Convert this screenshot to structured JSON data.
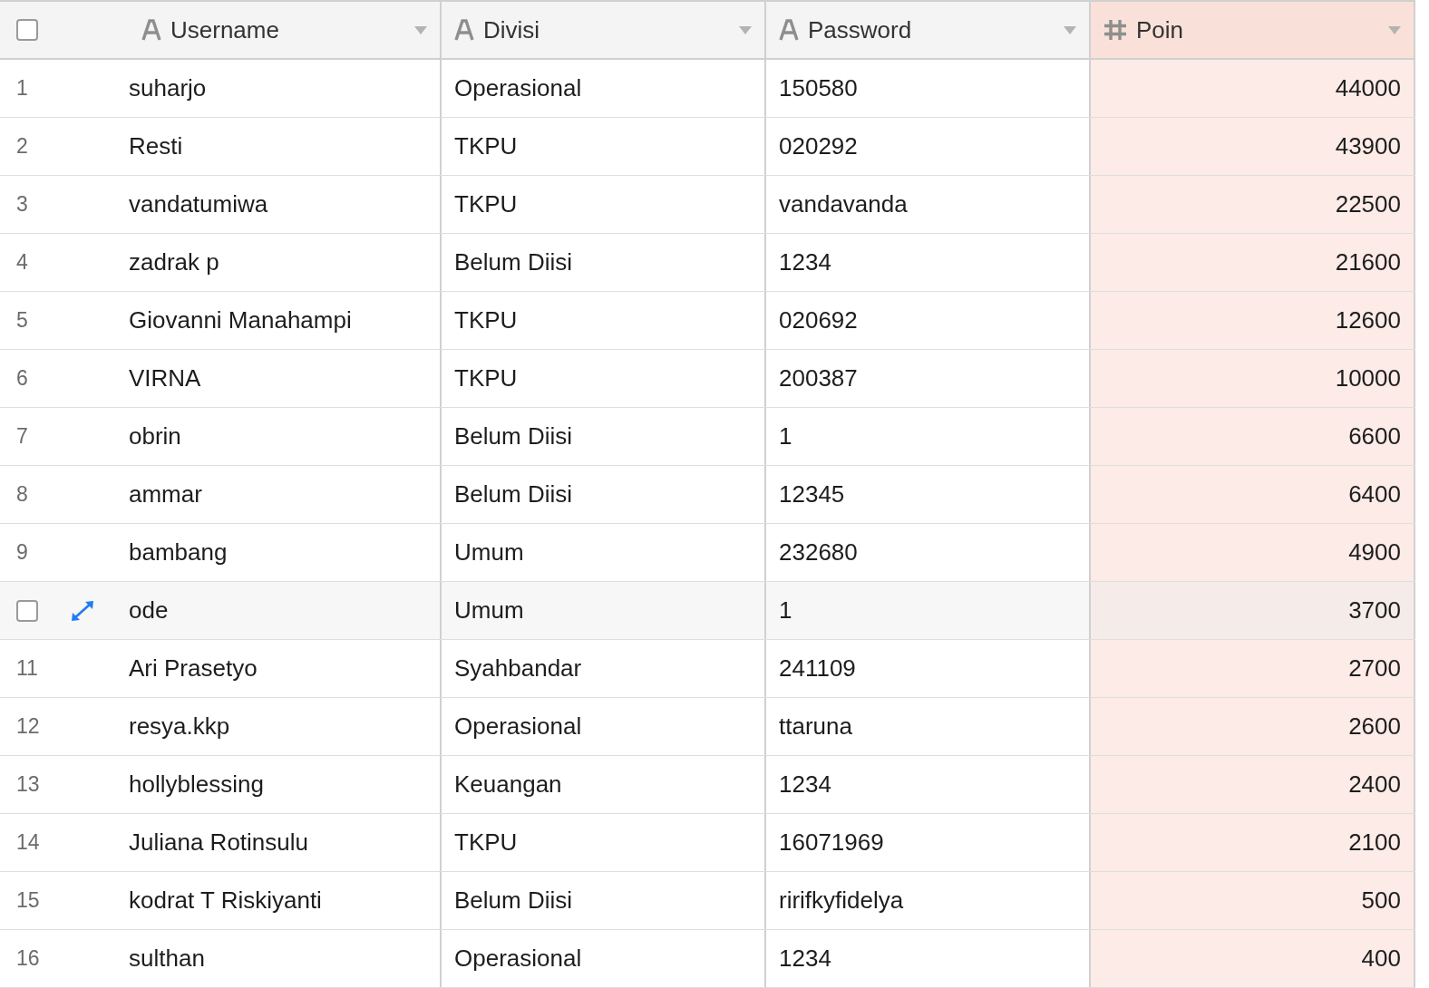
{
  "header_checkbox": {
    "checked": false
  },
  "columns": [
    {
      "label": "Username",
      "kind": "text",
      "highlighted": false
    },
    {
      "label": "Divisi",
      "kind": "text",
      "highlighted": false
    },
    {
      "label": "Password",
      "kind": "text",
      "highlighted": false
    },
    {
      "label": "Poin",
      "kind": "number",
      "highlighted": true
    }
  ],
  "rows": [
    {
      "number": "1",
      "hovered": false,
      "cells": [
        "suharjo",
        "Operasional",
        "150580",
        "44000"
      ]
    },
    {
      "number": "2",
      "hovered": false,
      "cells": [
        "Resti",
        "TKPU",
        "020292",
        "43900"
      ]
    },
    {
      "number": "3",
      "hovered": false,
      "cells": [
        "vandatumiwa",
        "TKPU",
        "vandavanda",
        "22500"
      ]
    },
    {
      "number": "4",
      "hovered": false,
      "cells": [
        "zadrak p",
        "Belum Diisi",
        "1234",
        "21600"
      ]
    },
    {
      "number": "5",
      "hovered": false,
      "cells": [
        "Giovanni Manahampi",
        "TKPU",
        "020692",
        "12600"
      ]
    },
    {
      "number": "6",
      "hovered": false,
      "cells": [
        "VIRNA",
        "TKPU",
        "200387",
        "10000"
      ]
    },
    {
      "number": "7",
      "hovered": false,
      "cells": [
        "obrin",
        "Belum Diisi",
        "1",
        "6600"
      ]
    },
    {
      "number": "8",
      "hovered": false,
      "cells": [
        "ammar",
        "Belum Diisi",
        "12345",
        "6400"
      ]
    },
    {
      "number": "9",
      "hovered": false,
      "cells": [
        "bambang",
        "Umum",
        "232680",
        "4900"
      ]
    },
    {
      "hovered": true,
      "checked": false,
      "cells": [
        "ode",
        "Umum",
        "1",
        "3700"
      ]
    },
    {
      "number": "11",
      "hovered": false,
      "cells": [
        "Ari Prasetyo",
        "Syahbandar",
        "241109",
        "2700"
      ]
    },
    {
      "number": "12",
      "hovered": false,
      "cells": [
        "resya.kkp",
        "Operasional",
        "ttaruna",
        "2600"
      ]
    },
    {
      "number": "13",
      "hovered": false,
      "cells": [
        "hollyblessing",
        "Keuangan",
        "1234",
        "2400"
      ]
    },
    {
      "number": "14",
      "hovered": false,
      "cells": [
        "Juliana Rotinsulu",
        "TKPU",
        "16071969",
        "2100"
      ]
    },
    {
      "number": "15",
      "hovered": false,
      "cells": [
        "kodrat T Riskiyanti",
        "Belum Diisi",
        "ririfkyfidelya",
        "500"
      ]
    },
    {
      "number": "16",
      "hovered": false,
      "cells": [
        "sulthan",
        "Operasional",
        "1234",
        "400"
      ]
    }
  ]
}
